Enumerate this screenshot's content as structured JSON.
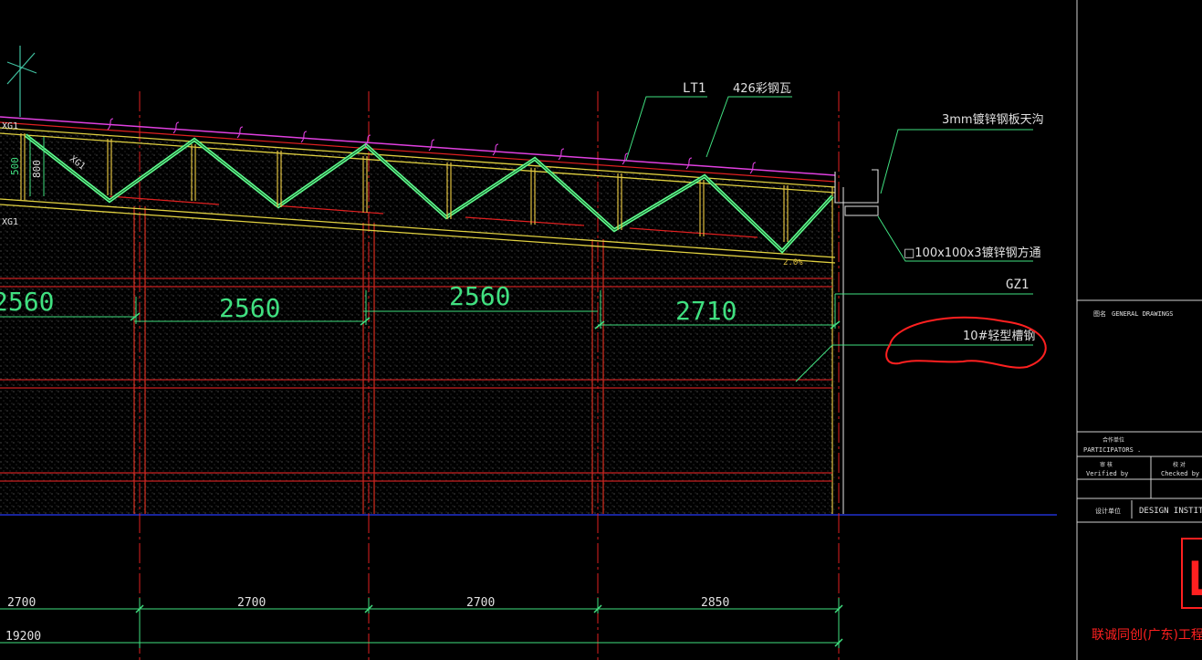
{
  "callouts": {
    "lt1": "LT1",
    "roof_sheet": "426彩钢瓦",
    "gutter": "3mm镀锌钢板天沟",
    "square_tube": "□100x100x3镀锌钢方通",
    "gz1": "GZ1",
    "channel_steel": "10#轻型槽钢"
  },
  "truss": {
    "xg1_top": "XG1",
    "xg1_diag": "XG1",
    "xg1_bottom": "XG1",
    "dim_500": "500",
    "dim_800": "800",
    "slope_note": "2.0%"
  },
  "panel_dims": [
    "2560",
    "2560",
    "2560",
    "2710"
  ],
  "axis_dims": [
    "2700",
    "2700",
    "2700",
    "2850"
  ],
  "total_dim": "19200",
  "title_block": {
    "drawing_label_cn": "图名",
    "drawing_label_en": "GENERAL DRAWINGS",
    "participants_cn": "合作单位",
    "participants_en": "PARTICIPATORS .",
    "verified_cn": "审 核",
    "verified_en": "Verified by",
    "checked_cn": "校 对",
    "checked_en": "Checked by",
    "design_unit_cn": "设计单位",
    "design_institute": "DESIGN INSTITU",
    "company_name": "联诚同创(广东)工程设",
    "logo_letter": "L"
  },
  "colors": {
    "background": "#000000",
    "axis_red": "#e02020",
    "dim_green": "#40e080",
    "truss_green": "#60ff90",
    "roof_magenta": "#e040e0",
    "chord_yellow": "#e0d040",
    "ground_blue": "#2030d0",
    "markup_red": "#ff2020"
  }
}
